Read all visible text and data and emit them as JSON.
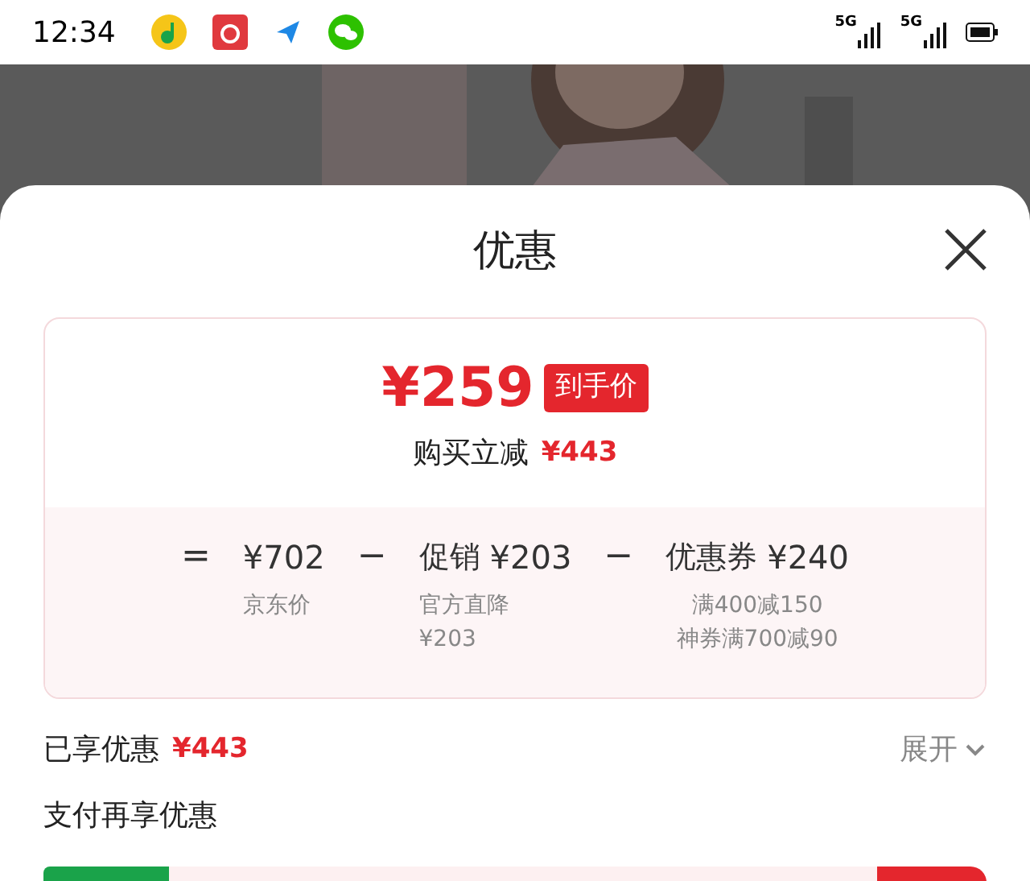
{
  "status_bar": {
    "time": "12:34",
    "network_labels": [
      "5G",
      "5G"
    ]
  },
  "sheet": {
    "title": "优惠"
  },
  "summary": {
    "final_price": "¥259",
    "final_badge": "到手价",
    "saving_label": "购买立减",
    "saving_amount": "¥443"
  },
  "breakdown": [
    {
      "sign": "=",
      "amount": "¥702",
      "notes": [
        "京东价"
      ]
    },
    {
      "sign": "−",
      "label": "促销",
      "amount": "¥203",
      "notes": [
        "官方直降",
        "¥203"
      ]
    },
    {
      "sign": "−",
      "label": "优惠券",
      "amount": "¥240",
      "notes": [
        "满400减150",
        "神券满700减90"
      ]
    }
  ],
  "enjoyed": {
    "label": "已享优惠",
    "amount": "¥443",
    "toggle": "展开"
  },
  "pay_section": {
    "title": "支付再享优惠"
  }
}
